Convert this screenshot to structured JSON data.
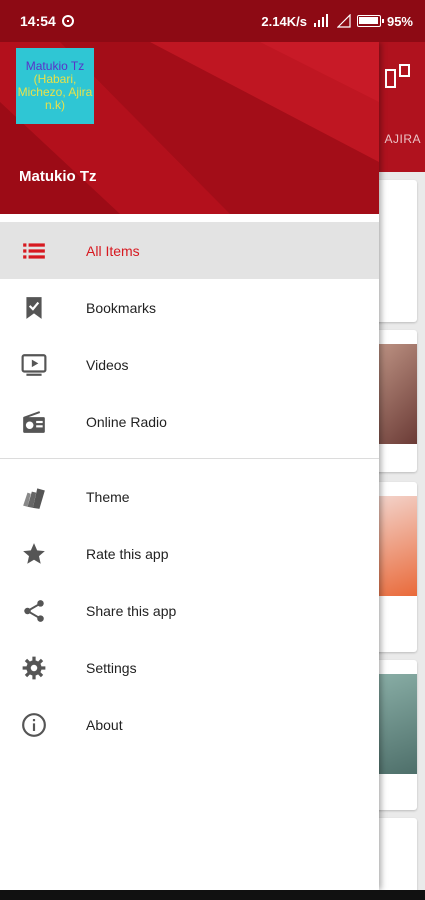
{
  "status_bar": {
    "time": "14:54",
    "network_speed": "2.14K/s",
    "battery": "95%"
  },
  "background_app": {
    "tab_label": "AJIRA"
  },
  "drawer": {
    "logo": {
      "line1": "Matukio Tz",
      "line2": "(Habari, Michezo, Ajira n.k)"
    },
    "app_name": "Matukio Tz",
    "items_primary": [
      {
        "label": "All Items",
        "icon": "list-icon",
        "active": true
      },
      {
        "label": "Bookmarks",
        "icon": "bookmark-icon"
      },
      {
        "label": "Videos",
        "icon": "video-icon"
      },
      {
        "label": "Online Radio",
        "icon": "radio-icon"
      }
    ],
    "items_secondary": [
      {
        "label": "Theme",
        "icon": "theme-icon"
      },
      {
        "label": "Rate this app",
        "icon": "star-icon"
      },
      {
        "label": "Share this app",
        "icon": "share-icon"
      },
      {
        "label": "Settings",
        "icon": "gear-icon"
      },
      {
        "label": "About",
        "icon": "info-icon"
      }
    ]
  },
  "colors": {
    "primary": "#b3101c",
    "accent": "#d71920",
    "status_bar": "#8d0a14"
  }
}
